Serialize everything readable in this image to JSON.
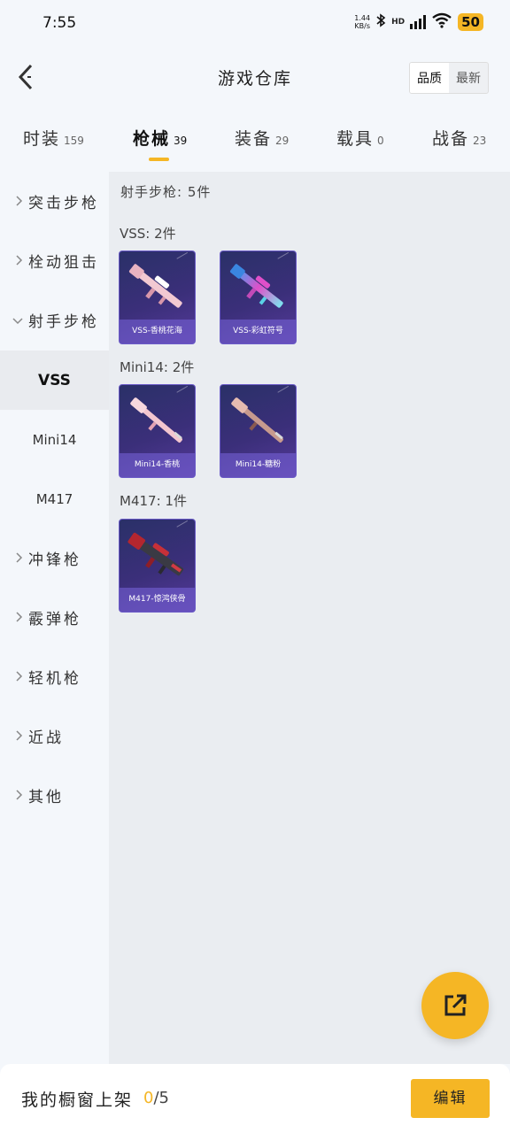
{
  "status_bar": {
    "time": "7:55",
    "net_speed_value": "1.44",
    "net_speed_unit": "KB/s",
    "bluetooth_icon": "bluetooth-icon",
    "hd_label": "HD",
    "battery": "50"
  },
  "header": {
    "title": "游戏仓库",
    "sort_options": [
      "品质",
      "最新"
    ]
  },
  "tabs": [
    {
      "label": "时装",
      "count": "159"
    },
    {
      "label": "枪械",
      "count": "39"
    },
    {
      "label": "装备",
      "count": "29"
    },
    {
      "label": "载具",
      "count": "0"
    },
    {
      "label": "战备",
      "count": "23"
    }
  ],
  "sidebar": {
    "items": [
      {
        "label": "突击步枪"
      },
      {
        "label": "栓动狙击"
      },
      {
        "label": "射手步枪"
      },
      {
        "label": "VSS"
      },
      {
        "label": "Mini14"
      },
      {
        "label": "M417"
      },
      {
        "label": "冲锋枪"
      },
      {
        "label": "霰弹枪"
      },
      {
        "label": "轻机枪"
      },
      {
        "label": "近战"
      },
      {
        "label": "其他"
      }
    ]
  },
  "content": {
    "category_summary": "射手步枪: 5件",
    "groups": [
      {
        "title": "VSS: 2件",
        "items": [
          {
            "name": "VSS-香桃花海"
          },
          {
            "name": "VSS-彩虹符号"
          }
        ]
      },
      {
        "title": "Mini14: 2件",
        "items": [
          {
            "name": "Mini14-香桃"
          },
          {
            "name": "Mini14-糖粉"
          }
        ]
      },
      {
        "title": "M417: 1件",
        "items": [
          {
            "name": "M417-惊鸿侠骨"
          }
        ]
      }
    ]
  },
  "bottom_bar": {
    "label": "我的橱窗上架",
    "current": "0",
    "total": "/5",
    "edit_label": "编辑"
  },
  "colors": {
    "accent": "#f5b625",
    "card_bg": "#3b2f7a"
  }
}
